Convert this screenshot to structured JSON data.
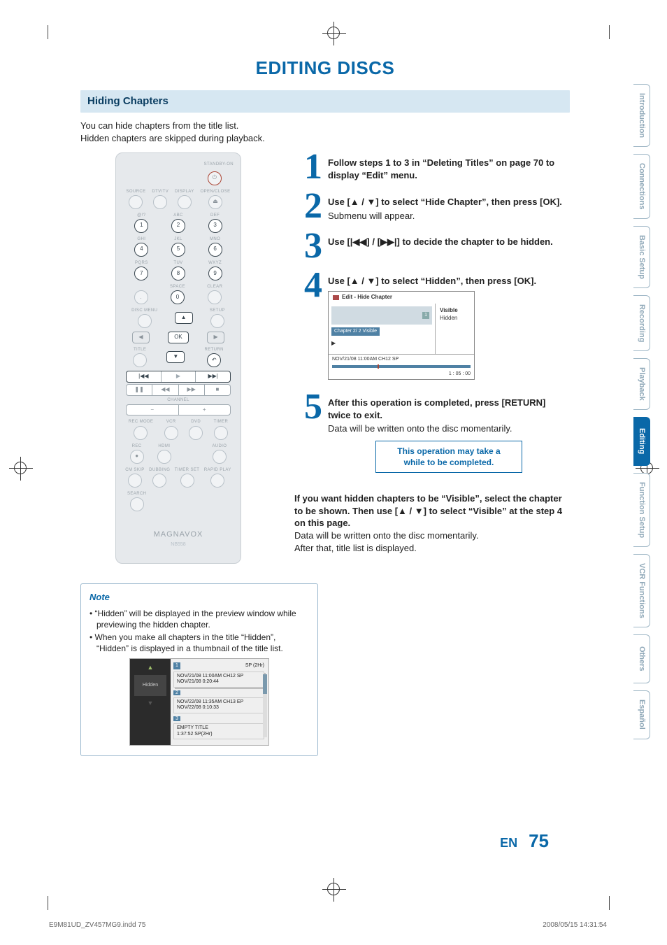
{
  "page": {
    "title": "EDITING DISCS",
    "section_heading": "Hiding Chapters",
    "intro_line1": "You can hide chapters from the title list.",
    "intro_line2": "Hidden chapters are skipped during playback.",
    "lang_code": "EN",
    "page_number": "75",
    "footer_file": "E9M81UD_ZV457MG9.indd   75",
    "footer_date": "2008/05/15   14:31:54"
  },
  "tabs": [
    {
      "label": "Introduction",
      "active": false
    },
    {
      "label": "Connections",
      "active": false
    },
    {
      "label": "Basic Setup",
      "active": false
    },
    {
      "label": "Recording",
      "active": false
    },
    {
      "label": "Playback",
      "active": false
    },
    {
      "label": "Editing",
      "active": true
    },
    {
      "label": "Function Setup",
      "active": false
    },
    {
      "label": "VCR Functions",
      "active": false
    },
    {
      "label": "Others",
      "active": false
    },
    {
      "label": "Español",
      "active": false
    }
  ],
  "remote": {
    "standby": "STANDBY-ON",
    "row1": [
      "SOURCE",
      "DTV/TV",
      "DISPLAY",
      "OPEN/CLOSE"
    ],
    "row2_labels": [
      "@!?",
      "ABC",
      "DEF"
    ],
    "row3_labels": [
      "GHI",
      "JKL",
      "MNO"
    ],
    "row4_labels": [
      "PQRS",
      "TUV",
      "WXYZ"
    ],
    "row5_labels": [
      "",
      "SPACE",
      "CLEAR"
    ],
    "numpad": [
      [
        "1",
        "2",
        "3"
      ],
      [
        "4",
        "5",
        "6"
      ],
      [
        "7",
        "8",
        "9"
      ],
      [
        ".",
        "0",
        ""
      ]
    ],
    "disc_menu": "DISC MENU",
    "setup": "SETUP",
    "ok": "OK",
    "title_lbl": "TITLE",
    "return_lbl": "RETURN",
    "channel": "CHANNEL",
    "recmode_row": [
      "REC MODE",
      "VCR",
      "DVD",
      "TIMER"
    ],
    "rec_row": [
      "REC",
      "HDMI",
      "",
      "AUDIO"
    ],
    "skip_row": [
      "CM SKIP",
      "DUBBING",
      "TIMER SET",
      "RAPID PLAY"
    ],
    "search": "SEARCH",
    "brand": "MAGNAVOX",
    "model": "NB558"
  },
  "steps": {
    "s1": {
      "num": "1",
      "text": "Follow steps 1 to 3 in “Deleting Titles” on page 70 to display “Edit” menu."
    },
    "s2": {
      "num": "2",
      "text": "Use [▲ / ▼] to select “Hide Chapter”, then press [OK].",
      "sub": "Submenu will appear."
    },
    "s3": {
      "num": "3",
      "text": "Use [|◀◀] / [▶▶|] to decide the chapter to be hidden."
    },
    "s4": {
      "num": "4",
      "text": "Use [▲ / ▼] to select “Hidden”, then press [OK]."
    },
    "s5": {
      "num": "5",
      "text": "After this operation is completed, press [RETURN] twice to exit.",
      "sub": "Data will be written onto the disc momentarily."
    }
  },
  "osd": {
    "title": "Edit - Hide Chapter",
    "thumb_label": "1",
    "right_opt1": "Visible",
    "right_opt2": "Hidden",
    "chapter_line": "Chapter    2/  2    Visible",
    "play": "▶",
    "foot": "NOV/21/08 11:00AM CH12 SP",
    "duration": "1 : 05 : 00"
  },
  "warn": {
    "line1": "This operation may take a",
    "line2": "while to be completed."
  },
  "after": {
    "bold": "If you want hidden chapters to be “Visible”, select the chapter to be shown. Then use [▲ / ▼] to select “Visible” at the step 4 on this page.",
    "line1": "Data will be written onto the disc momentarily.",
    "line2": "After that, title list is displayed."
  },
  "note": {
    "title": "Note",
    "items": [
      "“Hidden” will be displayed in the preview window while previewing the hidden chapter.",
      "When you make all chapters in the title “Hidden”, “Hidden” is displayed in a thumbnail of the title list."
    ]
  },
  "titlelist": {
    "thumb_label": "Hidden",
    "head_mode": "SP (2Hr)",
    "items": [
      {
        "n": "1",
        "l1": "NOV/21/08   11:00AM CH12  SP",
        "l2": "NOV/21/08    0:20:44"
      },
      {
        "n": "2",
        "l1": "NOV/22/08   11:35AM CH13  EP",
        "l2": "NOV/22/08    0:10:33"
      },
      {
        "n": "3",
        "l1": "EMPTY TITLE",
        "l2": "1:37:52   SP(2Hr)"
      }
    ]
  }
}
